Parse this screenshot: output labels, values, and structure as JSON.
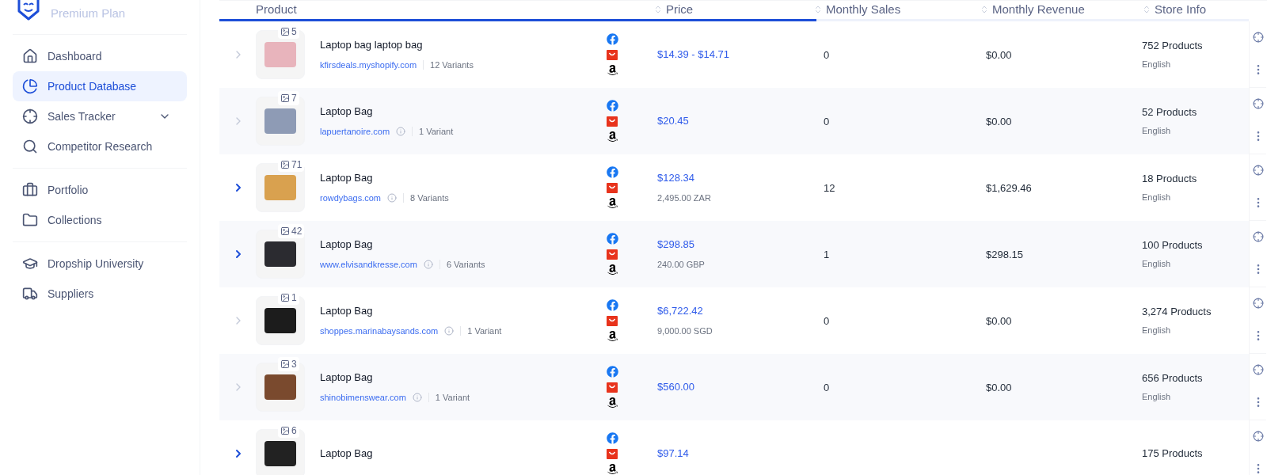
{
  "sidebar": {
    "plan": "Premium Plan",
    "groups": [
      [
        {
          "label": "Dashboard",
          "selected": false
        },
        {
          "label": "Product Database",
          "selected": true
        },
        {
          "label": "Sales Tracker",
          "selected": false,
          "expandable": true
        },
        {
          "label": "Competitor Research",
          "selected": false
        }
      ],
      [
        {
          "label": "Portfolio",
          "selected": false
        },
        {
          "label": "Collections",
          "selected": false
        }
      ],
      [
        {
          "label": "Dropship University",
          "selected": false
        },
        {
          "label": "Suppliers",
          "selected": false
        }
      ]
    ]
  },
  "table": {
    "columns": [
      "Product",
      "Price",
      "Monthly Sales",
      "Monthly Revenue",
      "Store Info"
    ],
    "loading_bar": {
      "level": 0.58
    },
    "rows": [
      {
        "expandable": false,
        "image_count": "5",
        "title": "Laptop bag laptop bag",
        "domain": "kfirsdeals.myshopify.com",
        "info": false,
        "variants": "12 Variants",
        "price": "$14.39 - $14.71",
        "sales": "0",
        "revenue": "$0.00",
        "products": "752 Products",
        "language": "English"
      },
      {
        "expandable": false,
        "image_count": "7",
        "title": "Laptop Bag",
        "domain": "lapuertanoire.com",
        "info": true,
        "variants": "1 Variant",
        "price": "$20.45",
        "sales": "0",
        "revenue": "$0.00",
        "products": "52 Products",
        "language": "English"
      },
      {
        "expandable": true,
        "image_count": "71",
        "title": "Laptop Bag",
        "domain": "rowdybags.com",
        "info": true,
        "variants": "8 Variants",
        "price": "$128.34",
        "local_price": "2,495.00 ZAR",
        "sales": "12",
        "revenue": "$1,629.46",
        "products": "18 Products",
        "language": "English"
      },
      {
        "expandable": true,
        "image_count": "42",
        "title": "Laptop Bag",
        "domain": "www.elvisandkresse.com",
        "info": true,
        "variants": "6 Variants",
        "price": "$298.85",
        "local_price": "240.00 GBP",
        "sales": "1",
        "revenue": "$298.15",
        "products": "100 Products",
        "language": "English"
      },
      {
        "expandable": false,
        "image_count": "1",
        "title": "Laptop Bag",
        "domain": "shoppes.marinabaysands.com",
        "info": true,
        "variants": "1 Variant",
        "price": "$6,722.42",
        "local_price": "9,000.00 SGD",
        "sales": "0",
        "revenue": "$0.00",
        "products": "3,274 Products",
        "language": "English"
      },
      {
        "expandable": false,
        "image_count": "3",
        "title": "Laptop Bag",
        "domain": "shinobimenswear.com",
        "info": true,
        "variants": "1 Variant",
        "price": "$560.00",
        "sales": "0",
        "revenue": "$0.00",
        "products": "656 Products",
        "language": "English"
      },
      {
        "expandable": true,
        "image_count": "6",
        "title": "Laptop Bag",
        "price": "$97.14",
        "products": "175 Products"
      }
    ]
  }
}
